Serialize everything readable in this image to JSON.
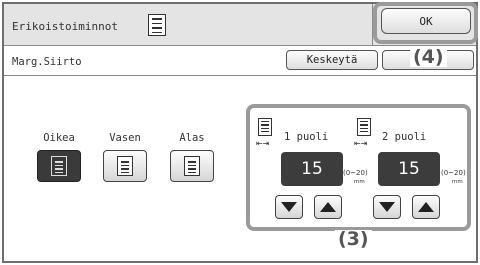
{
  "header": {
    "title": "Erikoistoiminnot",
    "ok_label": "OK"
  },
  "subheader": {
    "title": "Marg.Siirto",
    "cancel_label": "Keskeytä"
  },
  "callouts": {
    "ok": "(4)",
    "margins": "(3)"
  },
  "direction": {
    "options": [
      {
        "label": "Oikea",
        "selected": true
      },
      {
        "label": "Vasen",
        "selected": false
      },
      {
        "label": "Alas",
        "selected": false
      }
    ]
  },
  "margins": {
    "side1": {
      "label": "1 puoli",
      "value": "15",
      "range": "(0~20)",
      "unit": "mm"
    },
    "side2": {
      "label": "2 puoli",
      "value": "15",
      "range": "(0~20)",
      "unit": "mm"
    }
  },
  "colors": {
    "selected_button": "#3a3a3a",
    "value_display": "#3c3c3c",
    "highlight": "#9a9a9a"
  }
}
